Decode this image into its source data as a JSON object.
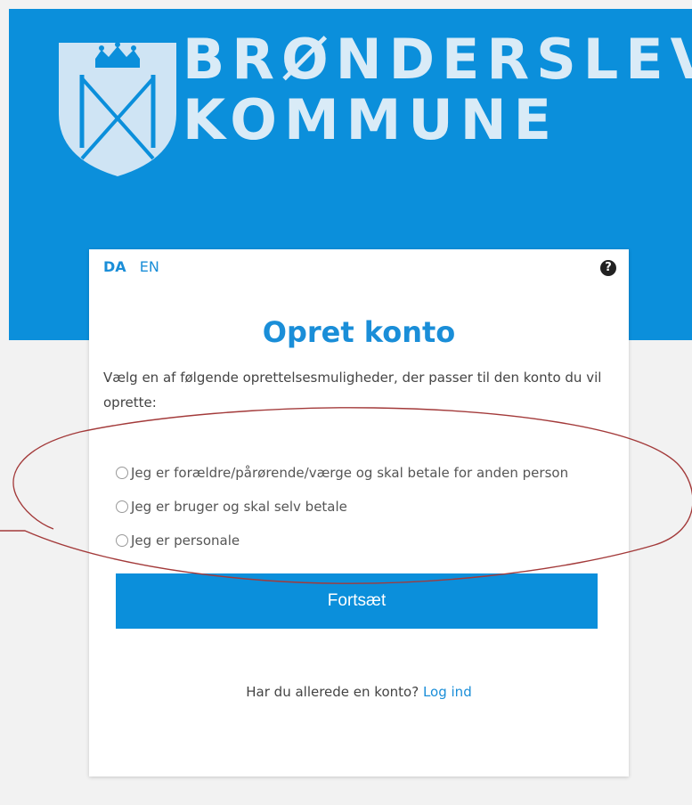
{
  "header": {
    "brand_line1": "BRØNDERSLEV",
    "brand_line2": "KOMMUNE",
    "logo_icon": "municipal-coat-of-arms",
    "brand_color": "#0b8fdb"
  },
  "card": {
    "languages": [
      "DA",
      "EN"
    ],
    "active_language": "DA",
    "help_icon": "question-circle-icon",
    "help_glyph": "?",
    "title": "Opret konto",
    "intro": "Vælg en af følgende oprettelsesmuligheder, der passer til den konto du vil oprette:",
    "options": [
      {
        "label": "Jeg er forældre/pårørende/værge og skal betale for anden person",
        "selected": false
      },
      {
        "label": "Jeg er bruger og skal selv betale",
        "selected": false
      },
      {
        "label": "Jeg er personale",
        "selected": false
      }
    ],
    "continue_label": "Fortsæt",
    "login_prompt": "Har du allerede en konto?",
    "login_link": "Log ind"
  },
  "annotation": {
    "shape": "ellipse",
    "color": "#a33a3a"
  }
}
